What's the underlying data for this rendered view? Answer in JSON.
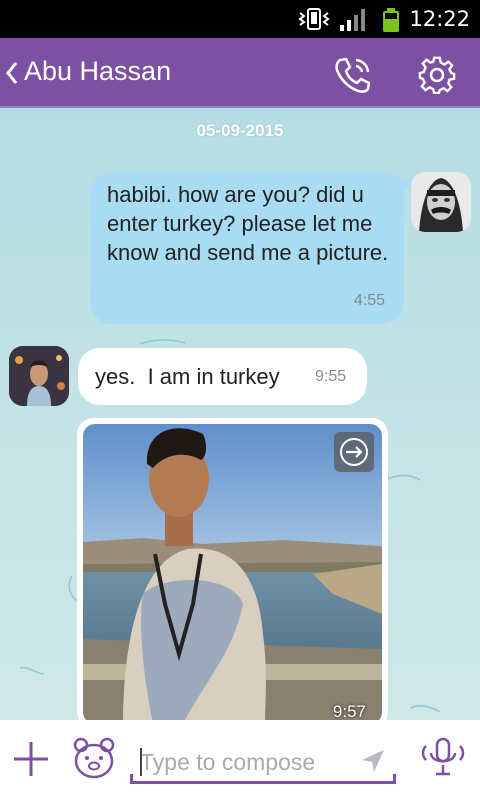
{
  "status_bar": {
    "time": "12:22",
    "icons": [
      "vibrate-icon",
      "signal-icon",
      "battery-icon"
    ]
  },
  "header": {
    "contact_name": "Abu Hassan",
    "background_color": "#7c51a1",
    "icons": [
      "back-chevron-icon",
      "phone-call-icon",
      "settings-gear-icon"
    ]
  },
  "chat": {
    "date_divider": "05-09-2015",
    "messages": [
      {
        "direction": "outgoing",
        "text": "habibi. how are you? did u enter turkey? please let me know and send me a picture.",
        "time": "4:55",
        "bubble_color": "#a9dcf2"
      },
      {
        "direction": "incoming",
        "text": "yes.  I am in turkey",
        "time": "9:55",
        "bubble_color": "#ffffff"
      },
      {
        "direction": "incoming",
        "type": "photo",
        "time": "9:57",
        "icons": [
          "forward-icon"
        ]
      }
    ]
  },
  "composer": {
    "placeholder": "Type to compose",
    "accent_color": "#7c51a1",
    "icons": [
      "plus-icon",
      "sticker-bear-icon",
      "send-arrow-icon",
      "microphone-icon"
    ]
  }
}
